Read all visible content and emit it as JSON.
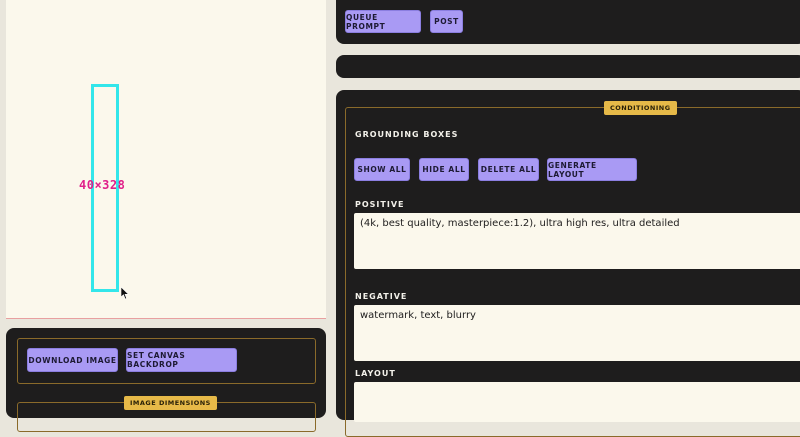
{
  "canvas": {
    "box_label": "40×328"
  },
  "toolbar": {
    "queue_prompt": "QUEUE PROMPT",
    "post": "POST"
  },
  "conditioning": {
    "legend": "CONDITIONING",
    "grounding_label": "GROUNDING BOXES",
    "buttons": {
      "show_all": "SHOW ALL",
      "hide_all": "HIDE ALL",
      "delete_all": "DELETE ALL",
      "generate_layout": "GENERATE LAYOUT"
    },
    "positive_label": "POSITIVE",
    "positive_value": "(4k, best quality, masterpiece:1.2), ultra high res, ultra detailed",
    "negative_label": "NEGATIVE",
    "negative_value": "watermark, text, blurry",
    "layout_label": "LAYOUT",
    "layout_value": ""
  },
  "image_tools": {
    "download_image": "DOWNLOAD IMAGE",
    "set_canvas_backdrop": "SET CANVAS BACKDROP",
    "image_dimensions_legend": "IMAGE DIMENSIONS"
  },
  "colors": {
    "accent_button": "#a99af4",
    "legend": "#e6b948",
    "box": "#33e6ea",
    "box_label": "#e0208a"
  }
}
